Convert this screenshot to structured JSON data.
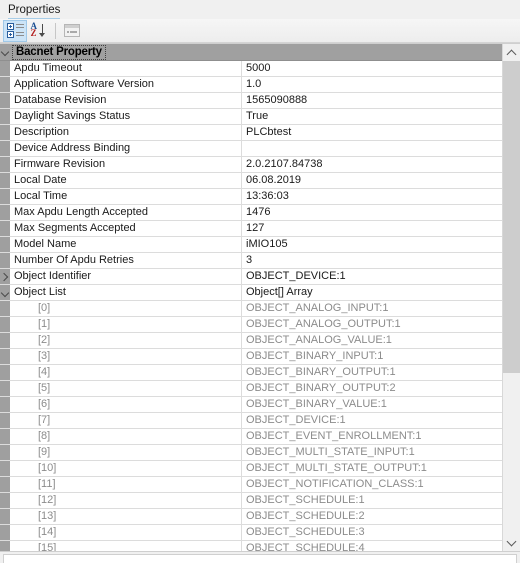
{
  "pane": {
    "title": "Properties"
  },
  "toolbar": {
    "buttons": [
      {
        "name": "categorized-view-button",
        "icon": "categorized-icon",
        "selected": true,
        "enabled": true
      },
      {
        "name": "alphabetical-sort-button",
        "icon": "sort-az-icon",
        "selected": false,
        "enabled": true
      },
      {
        "name": "property-pages-button",
        "icon": "property-page-icon",
        "selected": false,
        "enabled": false
      }
    ]
  },
  "grid": {
    "category": {
      "label": "Bacnet Property",
      "expanded": true,
      "expander_icon": "chevron-down-icon"
    },
    "rows": [
      {
        "name": "Apdu Timeout",
        "value": "5000",
        "indent": 0,
        "muted": false,
        "expander": ""
      },
      {
        "name": "Application Software Version",
        "value": "1.0",
        "indent": 0,
        "muted": false,
        "expander": ""
      },
      {
        "name": "Database Revision",
        "value": "1565090888",
        "indent": 0,
        "muted": false,
        "expander": ""
      },
      {
        "name": "Daylight Savings Status",
        "value": "True",
        "indent": 0,
        "muted": false,
        "expander": ""
      },
      {
        "name": "Description",
        "value": "PLCbtest",
        "indent": 0,
        "muted": false,
        "expander": ""
      },
      {
        "name": "Device Address Binding",
        "value": "",
        "indent": 0,
        "muted": false,
        "expander": ""
      },
      {
        "name": "Firmware Revision",
        "value": "2.0.2107.84738",
        "indent": 0,
        "muted": false,
        "expander": ""
      },
      {
        "name": "Local Date",
        "value": "06.08.2019",
        "indent": 0,
        "muted": false,
        "expander": ""
      },
      {
        "name": "Local Time",
        "value": "13:36:03",
        "indent": 0,
        "muted": false,
        "expander": ""
      },
      {
        "name": "Max Apdu Length Accepted",
        "value": "1476",
        "indent": 0,
        "muted": false,
        "expander": ""
      },
      {
        "name": "Max Segments Accepted",
        "value": "127",
        "indent": 0,
        "muted": false,
        "expander": ""
      },
      {
        "name": "Model Name",
        "value": "iMIO105",
        "indent": 0,
        "muted": false,
        "expander": ""
      },
      {
        "name": "Number Of Apdu Retries",
        "value": "3",
        "indent": 0,
        "muted": false,
        "expander": ""
      },
      {
        "name": "Object Identifier",
        "value": "OBJECT_DEVICE:1",
        "indent": 0,
        "muted": false,
        "expander": "chevron-right-icon"
      },
      {
        "name": "Object List",
        "value": "Object[] Array",
        "indent": 0,
        "muted": false,
        "expander": "chevron-down-icon"
      },
      {
        "name": "[0]",
        "value": "OBJECT_ANALOG_INPUT:1",
        "indent": 1,
        "muted": true,
        "expander": ""
      },
      {
        "name": "[1]",
        "value": "OBJECT_ANALOG_OUTPUT:1",
        "indent": 1,
        "muted": true,
        "expander": ""
      },
      {
        "name": "[2]",
        "value": "OBJECT_ANALOG_VALUE:1",
        "indent": 1,
        "muted": true,
        "expander": ""
      },
      {
        "name": "[3]",
        "value": "OBJECT_BINARY_INPUT:1",
        "indent": 1,
        "muted": true,
        "expander": ""
      },
      {
        "name": "[4]",
        "value": "OBJECT_BINARY_OUTPUT:1",
        "indent": 1,
        "muted": true,
        "expander": ""
      },
      {
        "name": "[5]",
        "value": "OBJECT_BINARY_OUTPUT:2",
        "indent": 1,
        "muted": true,
        "expander": ""
      },
      {
        "name": "[6]",
        "value": "OBJECT_BINARY_VALUE:1",
        "indent": 1,
        "muted": true,
        "expander": ""
      },
      {
        "name": "[7]",
        "value": "OBJECT_DEVICE:1",
        "indent": 1,
        "muted": true,
        "expander": ""
      },
      {
        "name": "[8]",
        "value": "OBJECT_EVENT_ENROLLMENT:1",
        "indent": 1,
        "muted": true,
        "expander": ""
      },
      {
        "name": "[9]",
        "value": "OBJECT_MULTI_STATE_INPUT:1",
        "indent": 1,
        "muted": true,
        "expander": ""
      },
      {
        "name": "[10]",
        "value": "OBJECT_MULTI_STATE_OUTPUT:1",
        "indent": 1,
        "muted": true,
        "expander": ""
      },
      {
        "name": "[11]",
        "value": "OBJECT_NOTIFICATION_CLASS:1",
        "indent": 1,
        "muted": true,
        "expander": ""
      },
      {
        "name": "[12]",
        "value": "OBJECT_SCHEDULE:1",
        "indent": 1,
        "muted": true,
        "expander": ""
      },
      {
        "name": "[13]",
        "value": "OBJECT_SCHEDULE:2",
        "indent": 1,
        "muted": true,
        "expander": ""
      },
      {
        "name": "[14]",
        "value": "OBJECT_SCHEDULE:3",
        "indent": 1,
        "muted": true,
        "expander": ""
      },
      {
        "name": "[15]",
        "value": "OBJECT_SCHEDULE:4",
        "indent": 1,
        "muted": true,
        "expander": ""
      }
    ]
  },
  "scrollbar": {
    "up_icon": "chevron-up-icon",
    "down_icon": "chevron-down-icon",
    "thumb_top_percent": 0,
    "thumb_height_percent": 66
  },
  "colors": {
    "category_header_bg": "#a0a0a0",
    "gutter": "#9f9f9f",
    "muted_text": "#8c8c8c",
    "selected_tool_bg": "#cce4f7",
    "accent_underline": "#a8cde8"
  }
}
